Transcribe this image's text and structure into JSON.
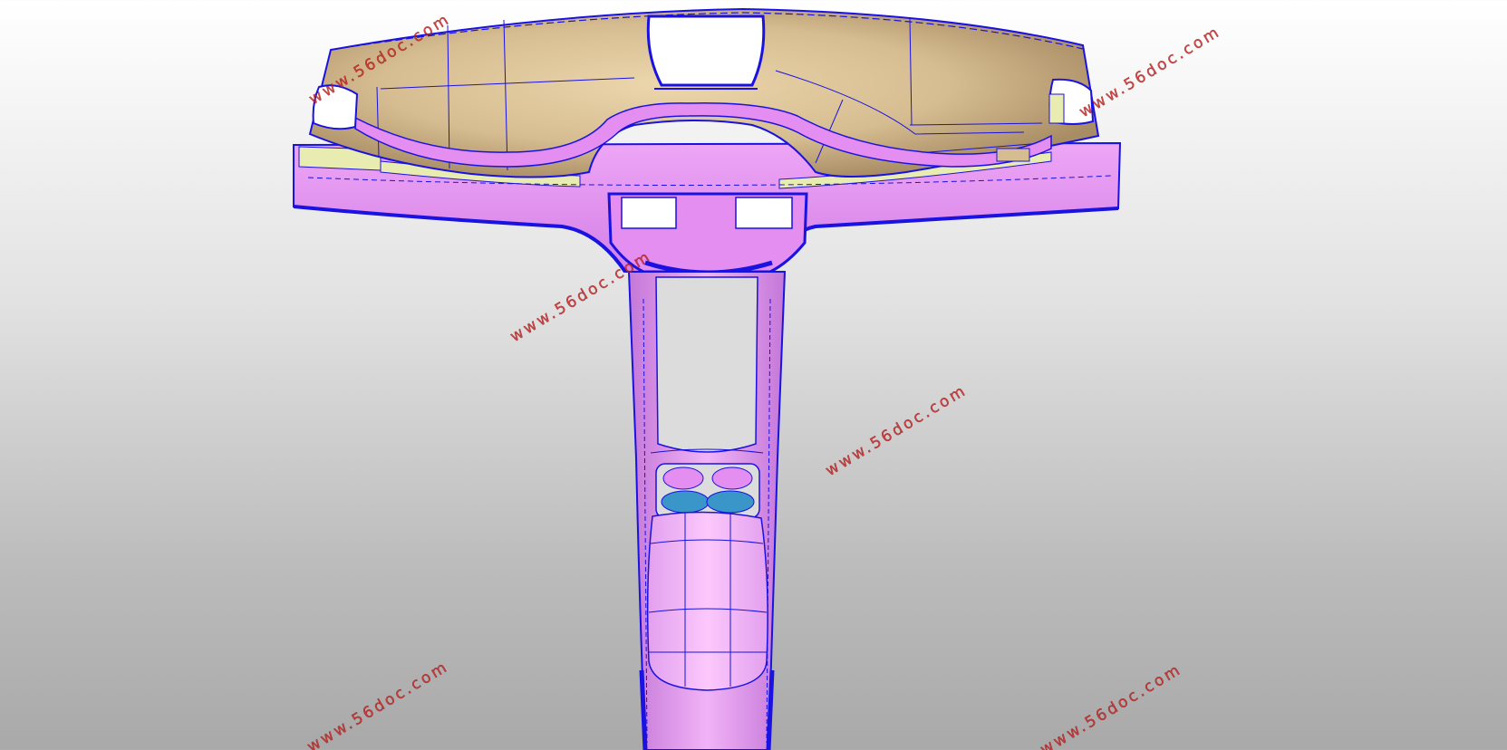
{
  "viewport": {
    "background_top": "#ffffff",
    "background_bottom": "#a9a9a9"
  },
  "colors": {
    "dashboard_tan": "#d2b88e",
    "dashboard_tan_light": "#e8d2a8",
    "panel_pink": "#e38ef0",
    "panel_pink_light": "#f3b6f8",
    "edge_blue": "#1a12e0",
    "accent_yellow": "#e9ecb0",
    "cup_blue": "#3a95c8",
    "watermark_red": "#cf2a2a"
  },
  "model": {
    "parts": [
      "instrument-panel",
      "lower-trim",
      "center-console",
      "cup-holder",
      "armrest"
    ]
  },
  "watermarks": [
    {
      "text": "www.56doc.com"
    },
    {
      "text": "www.56doc.com"
    },
    {
      "text": "www.56doc.com"
    },
    {
      "text": "www.56doc.com"
    },
    {
      "text": "www.56doc.com"
    },
    {
      "text": "www.56doc.com"
    }
  ]
}
